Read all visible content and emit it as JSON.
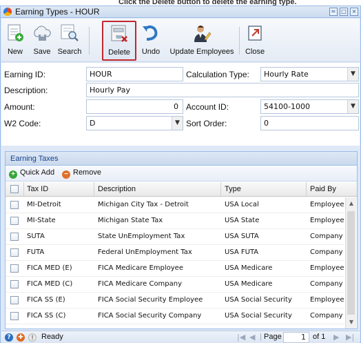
{
  "top_caption": "Click the Delete button to delete the earning type.",
  "window": {
    "title": "Earning Types - HOUR",
    "controls": {
      "restore": "≈",
      "maximize": "□",
      "close": "×"
    }
  },
  "toolbar": {
    "new": "New",
    "save": "Save",
    "search": "Search",
    "delete": "Delete",
    "undo": "Undo",
    "update_employees": "Update Employees",
    "close": "Close"
  },
  "form": {
    "earning_id_label": "Earning ID:",
    "earning_id_value": "HOUR",
    "calc_type_label": "Calculation Type:",
    "calc_type_value": "Hourly Rate",
    "description_label": "Description:",
    "description_value": "Hourly Pay",
    "amount_label": "Amount:",
    "amount_value": "0",
    "account_id_label": "Account ID:",
    "account_id_value": "54100-1000",
    "w2_code_label": "W2 Code:",
    "w2_code_value": "D",
    "sort_order_label": "Sort Order:",
    "sort_order_value": "0"
  },
  "earning_taxes": {
    "title": "Earning Taxes",
    "quick_add": "Quick Add",
    "remove": "Remove",
    "columns": {
      "tax_id": "Tax ID",
      "description": "Description",
      "type": "Type",
      "paid_by": "Paid By"
    },
    "rows": [
      {
        "tax_id": "MI-Detroit",
        "description": "Michigan City Tax - Detroit",
        "type": "USA Local",
        "paid_by": "Employee"
      },
      {
        "tax_id": "MI-State",
        "description": "Michigan State Tax",
        "type": "USA State",
        "paid_by": "Employee"
      },
      {
        "tax_id": "SUTA",
        "description": "State UnEmployment Tax",
        "type": "USA SUTA",
        "paid_by": "Company"
      },
      {
        "tax_id": "FUTA",
        "description": "Federal UnEmployment Tax",
        "type": "USA FUTA",
        "paid_by": "Company"
      },
      {
        "tax_id": "FICA MED (E)",
        "description": "FICA Medicare Employee",
        "type": "USA Medicare",
        "paid_by": "Employee"
      },
      {
        "tax_id": "FICA MED (C)",
        "description": "FICA Medicare Company",
        "type": "USA Medicare",
        "paid_by": "Company"
      },
      {
        "tax_id": "FICA SS (E)",
        "description": "FICA Social Security Employee",
        "type": "USA Social Security",
        "paid_by": "Employee"
      },
      {
        "tax_id": "FICA SS (C)",
        "description": "FICA Social Security Company",
        "type": "USA Social Security",
        "paid_by": "Company"
      }
    ]
  },
  "status": {
    "text": "Ready",
    "page_label": "Page",
    "page_value": "1",
    "of_label": "of 1"
  }
}
